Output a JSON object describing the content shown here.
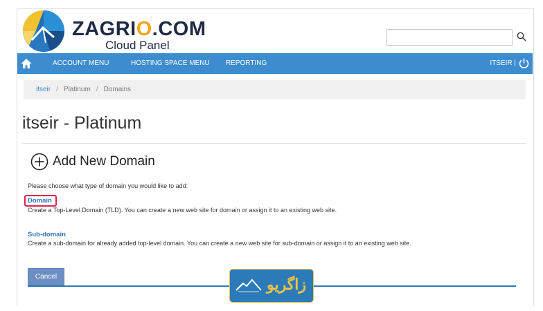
{
  "brand": {
    "name_part1": "ZAGRI",
    "name_o": "O",
    "name_part2": ".COM",
    "subtitle": "Cloud Panel"
  },
  "search": {
    "placeholder": "",
    "icon": "search-icon"
  },
  "nav": {
    "home_icon": "home-icon",
    "items": [
      {
        "label": "ACCOUNT MENU"
      },
      {
        "label": "HOSTING SPACE MENU"
      },
      {
        "label": "REPORTING"
      }
    ],
    "user_label": "ITSEIR |",
    "power_icon": "power-icon"
  },
  "breadcrumb": {
    "items": [
      "itseir",
      "Platinum",
      "Domains"
    ],
    "separator": "/"
  },
  "page_title": "itseir - Platinum",
  "section": {
    "icon": "plus-circle-icon",
    "title": "Add New Domain",
    "prompt": "Please choose what type of domain you would like to add:"
  },
  "options": [
    {
      "title": "Domain",
      "description": "Create a Top-Level Domain (TLD). You can create a new web site for domain or assign it to an existing web site."
    },
    {
      "title": "Sub-domain",
      "description": "Create a sub-domain for already added top-level domain. You can create a new web site for sub-domain or assign it to an existing web site."
    }
  ],
  "cancel_label": "Cancel",
  "badge": {
    "text": "زاگریو"
  },
  "colors": {
    "nav": "#3c8ccf",
    "link": "#2c74bf",
    "highlight": "#d9234a",
    "accent": "#f2a51a"
  }
}
